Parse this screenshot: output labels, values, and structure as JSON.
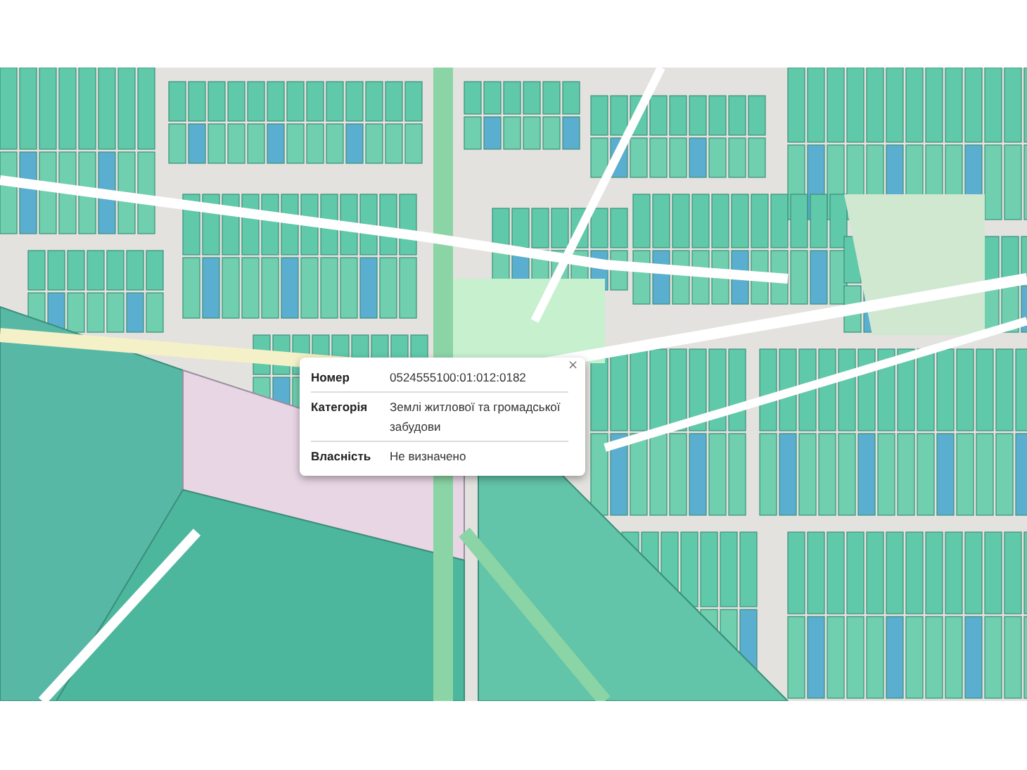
{
  "popup": {
    "close": "×",
    "rows": [
      {
        "label": "Номер",
        "value": "0524555100:01:012:0182"
      },
      {
        "label": "Категорія",
        "value": "Землі житлової та громадської забудови"
      },
      {
        "label": "Власність",
        "value": "Не визначено"
      }
    ]
  }
}
